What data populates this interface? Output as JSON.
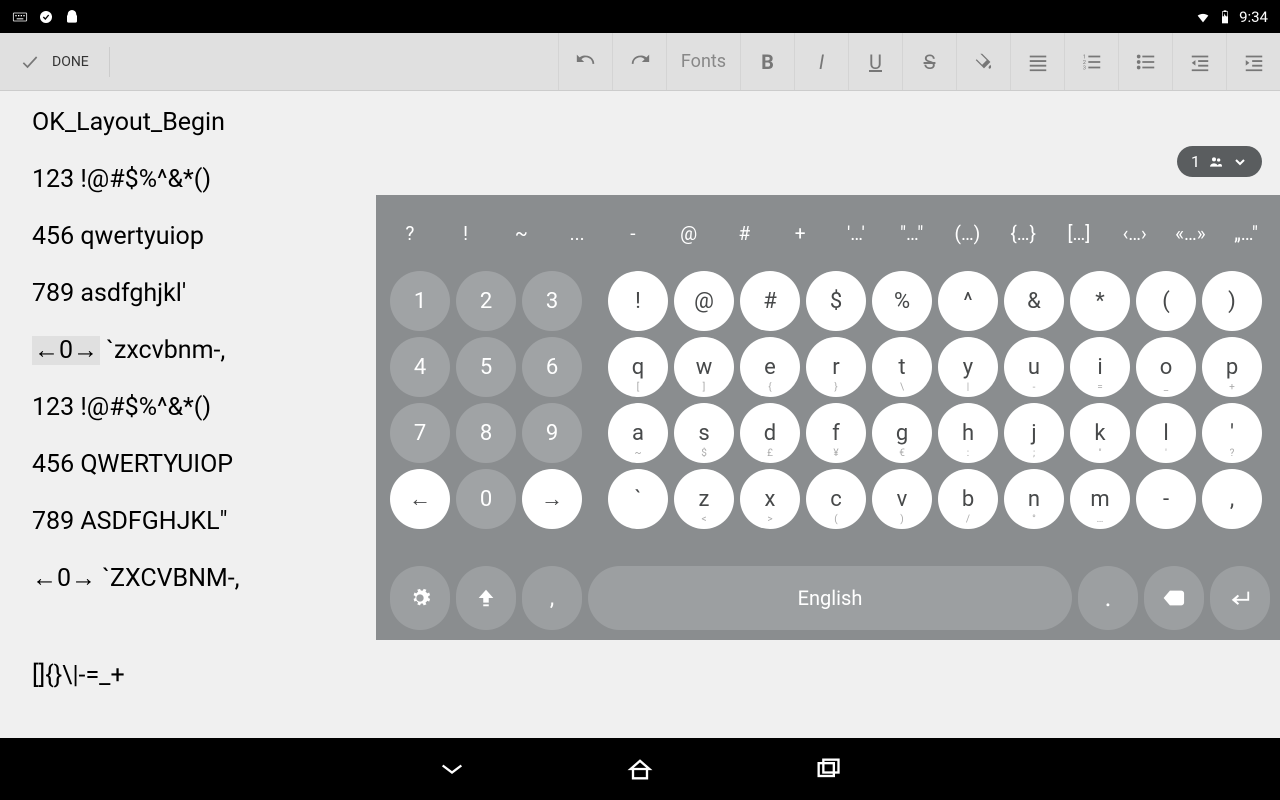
{
  "status": {
    "time": "9:34"
  },
  "toolbar": {
    "done": "DONE",
    "fonts": "Fonts"
  },
  "pill": {
    "count": "1"
  },
  "editor": {
    "lines": [
      "OK_Layout_Begin",
      "123 !@#$%^&*()",
      "456 qwertyuiop",
      "789 asdfghjkl'",
      {
        "hl": "←0→",
        "rest": " `zxcvbnm-,"
      },
      "123 !@#$%^&*()",
      "456 QWERTYUIOP",
      "789 ASDFGHJKL\"",
      "←0→ `ZXCVBNM-,",
      "",
      "[]{}\\|-=_+"
    ]
  },
  "keyboard": {
    "suggestions": [
      "?",
      "!",
      "~",
      "...",
      "-",
      "@",
      "#",
      "+",
      "'…'",
      "\"…\"",
      "(…)",
      "{…}",
      "[…]",
      "‹…›",
      "«…»",
      "„…\""
    ],
    "numpad": [
      [
        "1",
        "2",
        "3"
      ],
      [
        "4",
        "5",
        "6"
      ],
      [
        "7",
        "8",
        "9"
      ],
      [
        "←",
        "0",
        "→"
      ]
    ],
    "rows": [
      [
        {
          "m": "!"
        },
        {
          "m": "@"
        },
        {
          "m": "#"
        },
        {
          "m": "$"
        },
        {
          "m": "%"
        },
        {
          "m": "^"
        },
        {
          "m": "&"
        },
        {
          "m": "*"
        },
        {
          "m": "("
        },
        {
          "m": ")"
        }
      ],
      [
        {
          "m": "q",
          "s": "["
        },
        {
          "m": "w",
          "s": "]"
        },
        {
          "m": "e",
          "s": "{"
        },
        {
          "m": "r",
          "s": "}"
        },
        {
          "m": "t",
          "s": "\\"
        },
        {
          "m": "y",
          "s": "|"
        },
        {
          "m": "u",
          "s": "-"
        },
        {
          "m": "i",
          "s": "="
        },
        {
          "m": "o",
          "s": "_"
        },
        {
          "m": "p",
          "s": "+"
        }
      ],
      [
        {
          "m": "a",
          "s": "~"
        },
        {
          "m": "s",
          "s": "$"
        },
        {
          "m": "d",
          "s": "£"
        },
        {
          "m": "f",
          "s": "¥"
        },
        {
          "m": "g",
          "s": "€"
        },
        {
          "m": "h",
          "s": ":"
        },
        {
          "m": "j",
          "s": ";"
        },
        {
          "m": "k",
          "s": "\""
        },
        {
          "m": "l",
          "s": "'"
        },
        {
          "m": "'",
          "s": "?"
        }
      ],
      [
        {
          "m": "`"
        },
        {
          "m": "z",
          "s": "<"
        },
        {
          "m": "x",
          "s": ">"
        },
        {
          "m": "c",
          "s": "("
        },
        {
          "m": "v",
          "s": ")"
        },
        {
          "m": "b",
          "s": "/"
        },
        {
          "m": "n",
          "s": "°"
        },
        {
          "m": "m",
          "s": "…"
        },
        {
          "m": "-",
          "s": ""
        },
        {
          "m": ",",
          "s": ""
        }
      ]
    ],
    "space": "English",
    "comma": ",",
    "period": "."
  }
}
